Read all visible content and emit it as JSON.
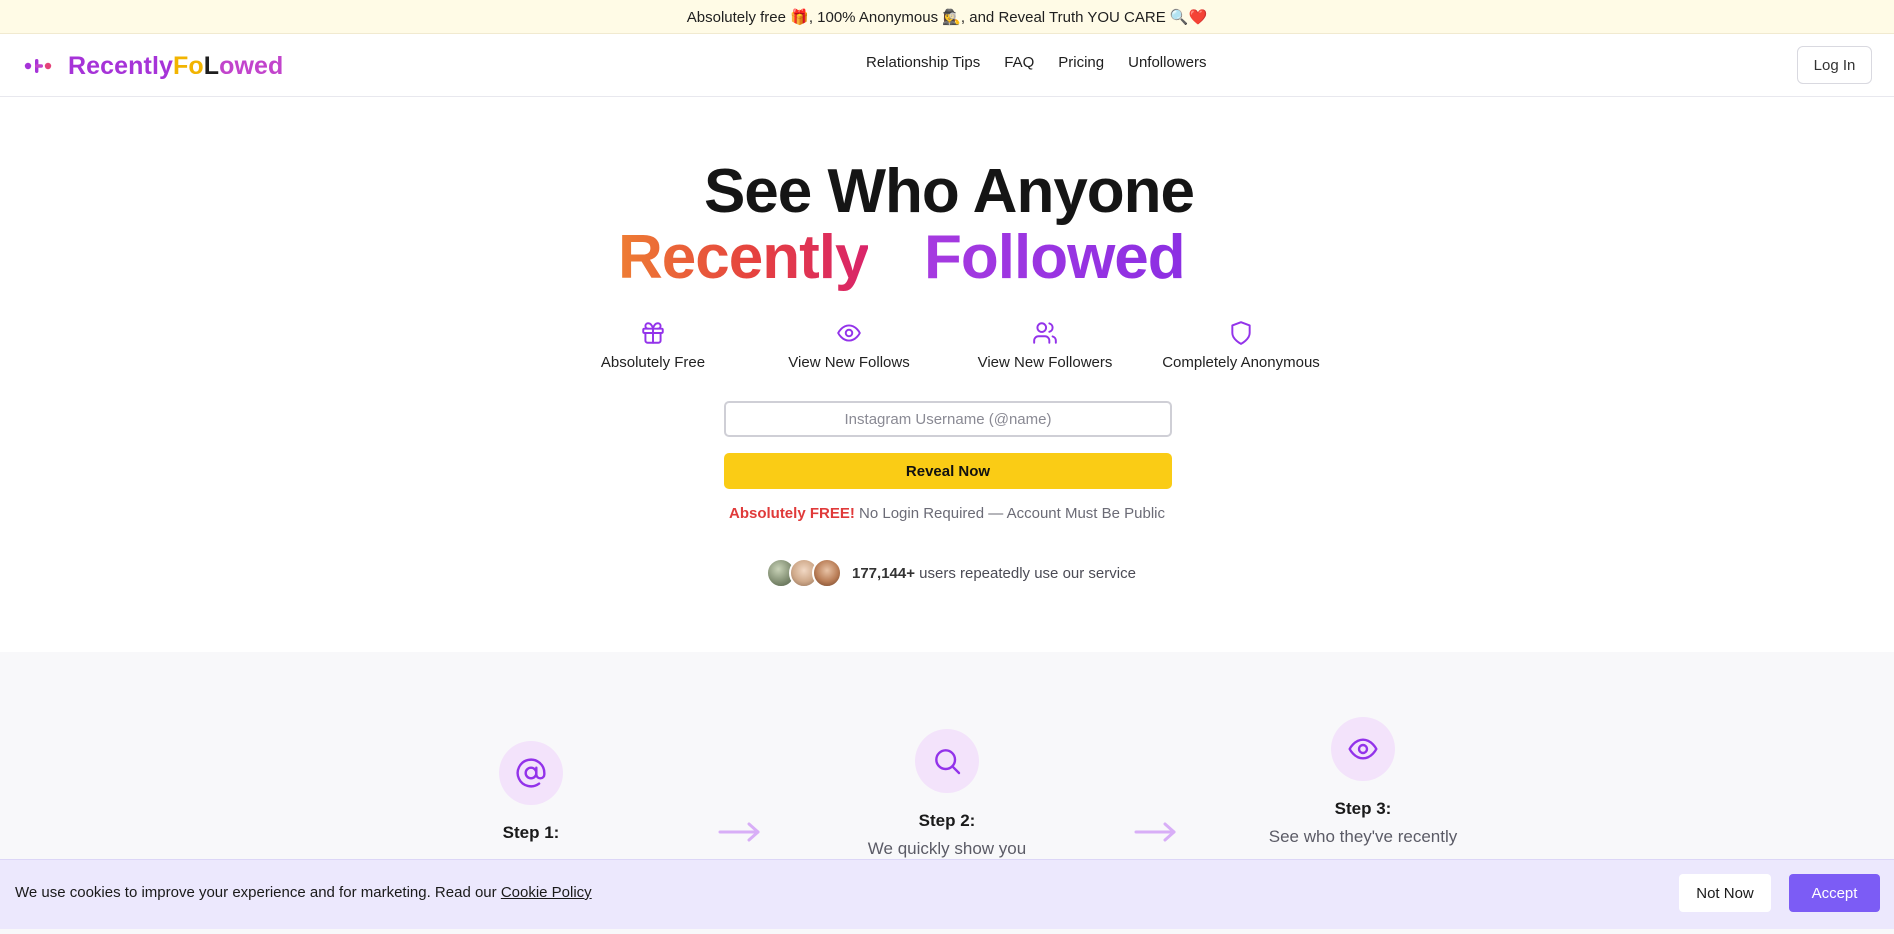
{
  "announcement": {
    "text": "Absolutely free 🎁, 100% Anonymous 🕵️‍♀️, and Reveal Truth YOU CARE 🔍❤️"
  },
  "header": {
    "logo_parts": [
      "Recently",
      "Fo",
      "L",
      "owed"
    ],
    "nav": [
      "Relationship Tips",
      "FAQ",
      "Pricing",
      "Unfollowers"
    ],
    "login_label": "Log In"
  },
  "hero": {
    "line1": "See Who Anyone",
    "word_recently": "Recently",
    "word_followed": "Followed"
  },
  "features": [
    {
      "label": "Absolutely Free",
      "icon": "gift-icon"
    },
    {
      "label": "View New Follows",
      "icon": "eye-icon"
    },
    {
      "label": "View New Followers",
      "icon": "users-icon"
    },
    {
      "label": "Completely Anonymous",
      "icon": "shield-icon"
    }
  ],
  "form": {
    "placeholder": "Instagram Username (@name)",
    "value": "",
    "button_label": "Reveal Now",
    "note_strong": "Absolutely FREE!",
    "note_rest": " No Login Required — Account Must Be Public"
  },
  "social_proof": {
    "count": "177,144+",
    "text": " users repeatedly use our service"
  },
  "steps": [
    {
      "title": "Step 1:",
      "desc": "",
      "icon": "at-sign-icon"
    },
    {
      "title": "Step 2:",
      "desc": "We quickly show you",
      "icon": "search-icon"
    },
    {
      "title": "Step 3:",
      "desc": "See who they've recently",
      "icon": "eye-icon"
    }
  ],
  "cookie": {
    "text": "We use cookies to improve your experience and for marketing. Read our ",
    "link": "Cookie Policy",
    "not_now": "Not Now",
    "accept": "Accept"
  },
  "colors": {
    "accent_purple": "#9333ea",
    "cta_yellow": "#facc15",
    "accept_purple": "#7c5cf5",
    "free_red": "#e03a3a"
  }
}
